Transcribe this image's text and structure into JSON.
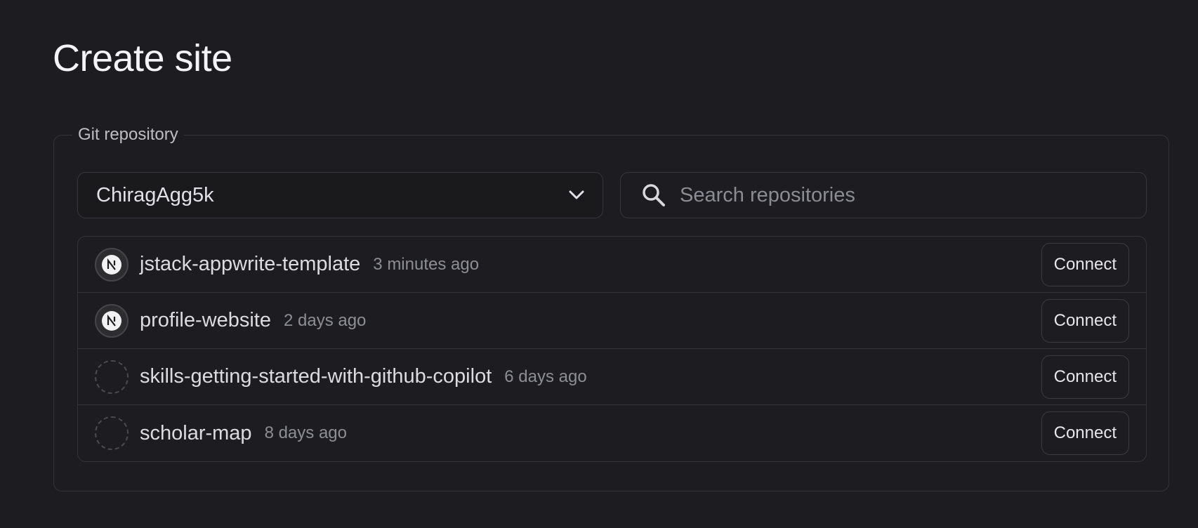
{
  "page": {
    "title": "Create site"
  },
  "git_repository": {
    "legend": "Git repository",
    "account_select": {
      "value": "ChiragAgg5k"
    },
    "search": {
      "placeholder": "Search repositories",
      "value": ""
    },
    "repositories": [
      {
        "name": "jstack-appwrite-template",
        "updated": "3 minutes ago",
        "framework_icon": "nextjs-icon",
        "connect_label": "Connect"
      },
      {
        "name": "profile-website",
        "updated": "2 days ago",
        "framework_icon": "nextjs-icon",
        "connect_label": "Connect"
      },
      {
        "name": "skills-getting-started-with-github-copilot",
        "updated": "6 days ago",
        "framework_icon": "placeholder-icon",
        "connect_label": "Connect"
      },
      {
        "name": "scholar-map",
        "updated": "8 days ago",
        "framework_icon": "placeholder-icon",
        "connect_label": "Connect"
      }
    ]
  }
}
